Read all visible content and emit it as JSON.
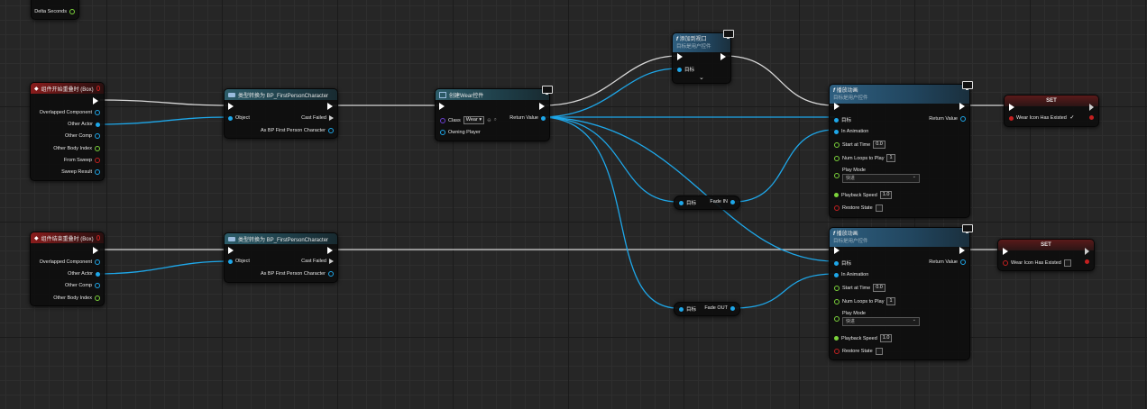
{
  "colors": {
    "exec": "#ffffff",
    "object": "#1ea7e9",
    "int": "#7cd33b",
    "bool": "#c42020",
    "class": "#6b3fd1"
  },
  "delta": {
    "label": "Delta Seconds"
  },
  "begin": {
    "title": "组件开始重叠时 (Box)",
    "pins": [
      "Overlapped Component",
      "Other Actor",
      "Other Comp",
      "Other Body Index",
      "From Sweep",
      "Sweep Result"
    ]
  },
  "end": {
    "title": "组件结束重叠时 (Box)",
    "pins": [
      "Overlapped Component",
      "Other Actor",
      "Other Comp",
      "Other Body Index"
    ]
  },
  "cast1": {
    "title": "类型转换为 BP_FirstPersonCharacter",
    "object": "Object",
    "failed": "Cast Failed",
    "as": "As BP First Person Character"
  },
  "cast2": {
    "title": "类型转换为 BP_FirstPersonCharacter",
    "object": "Object",
    "failed": "Cast Failed",
    "as": "As BP First Person Character"
  },
  "create": {
    "title": "创建Wear控件",
    "class_label": "Class",
    "class_value": "Wear",
    "owning": "Owning Player",
    "ret": "Return Value"
  },
  "addvp": {
    "title": "添加到视口",
    "sub": "目标是用户控件",
    "target": "目标"
  },
  "play1": {
    "title": "播放动画",
    "sub": "目标是用户控件",
    "target": "目标",
    "inanim": "In Animation",
    "start": "Start at Time",
    "start_val": "0.0",
    "loops": "Num Loops to Play",
    "loops_val": "1",
    "mode": "Play Mode",
    "mode_val": "快进",
    "speed": "Playback Speed",
    "speed_val": "1.0",
    "restore": "Restore State",
    "ret": "Return Value"
  },
  "play2": {
    "title": "播放动画",
    "sub": "目标是用户控件",
    "target": "目标",
    "inanim": "In Animation",
    "start": "Start at Time",
    "start_val": "0.0",
    "loops": "Num Loops to Play",
    "loops_val": "1",
    "mode": "Play Mode",
    "mode_val": "快进",
    "speed": "Playback Speed",
    "speed_val": "1.0",
    "restore": "Restore State",
    "ret": "Return Value"
  },
  "fadein": {
    "target": "目标",
    "label": "Fade IN"
  },
  "fadeout": {
    "target": "目标",
    "label": "Fade OUT"
  },
  "set1": {
    "title": "SET",
    "var": "Wear Icon Has Existed",
    "checked": "✓"
  },
  "set2": {
    "title": "SET",
    "var": "Wear Icon Has Existed"
  }
}
